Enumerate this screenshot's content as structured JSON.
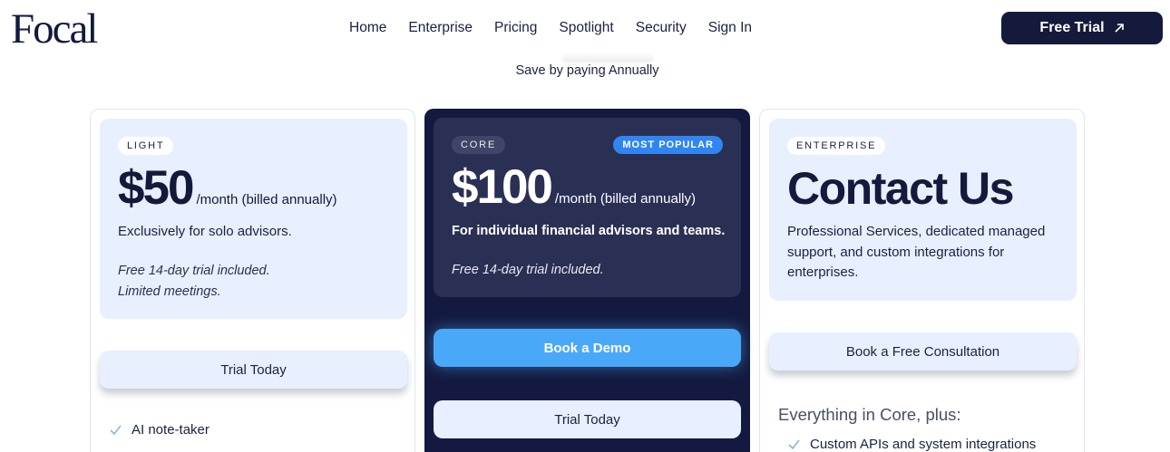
{
  "header": {
    "logo": "Focal",
    "nav": [
      "Home",
      "Enterprise",
      "Pricing",
      "Spotlight",
      "Security",
      "Sign In"
    ],
    "cta_label": "Free Trial"
  },
  "billing": {
    "note": "Save by paying Annually"
  },
  "plans": [
    {
      "tier": "LIGHT",
      "price": "$50",
      "period": "/month (billed annually)",
      "description": "Exclusively for solo advisors.",
      "notes": [
        "Free 14-day trial included.",
        "Limited meetings."
      ],
      "buttons": [
        "Trial Today"
      ],
      "features": [
        "AI note-taker"
      ]
    },
    {
      "tier": "CORE",
      "badge": "MOST POPULAR",
      "price": "$100",
      "period": "/month (billed annually)",
      "description": "For individual financial advisors and teams.",
      "notes": [
        "Free 14-day trial included."
      ],
      "buttons": [
        "Book a Demo",
        "Trial Today"
      ]
    },
    {
      "tier": "ENTERPRISE",
      "headline": "Contact Us",
      "description": "Professional Services, dedicated managed support, and custom integrations for enterprises.",
      "buttons": [
        "Book a Free Consultation"
      ],
      "features_heading": "Everything in Core, plus:",
      "features": [
        "Custom APIs and system integrations"
      ]
    }
  ],
  "colors": {
    "navy": "#141a3c",
    "card_tint": "#e8efff",
    "accent_blue": "#4aa8f8",
    "popular_badge": "#2f86f2",
    "check": "#8fb4d8"
  },
  "icons": {
    "cta": "arrow-up-right-icon",
    "feature": "check-icon"
  }
}
